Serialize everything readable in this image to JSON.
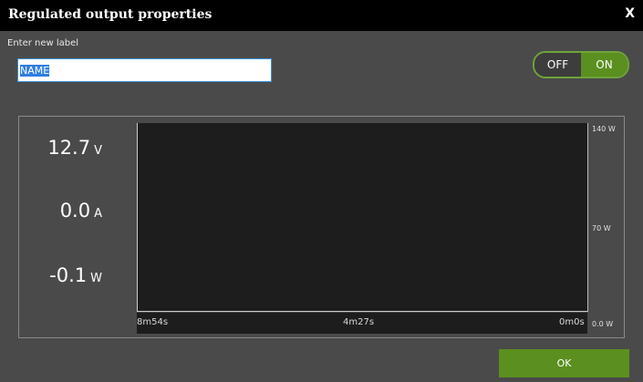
{
  "dialog": {
    "title": "Regulated output properties",
    "close_label": "X"
  },
  "label": {
    "caption": "Enter new label",
    "value": "NAME"
  },
  "toggle": {
    "off_label": "OFF",
    "on_label": "ON",
    "state": "on"
  },
  "readings": {
    "voltage": {
      "value": "12.7",
      "unit": "V"
    },
    "current": {
      "value": "0.0",
      "unit": "A"
    },
    "power": {
      "value": "-0.1",
      "unit": "W"
    }
  },
  "chart_data": {
    "type": "line",
    "x_tick_labels": [
      "8m54s",
      "4m27s",
      "0m0s"
    ],
    "y_tick_labels": [
      "140 W",
      "70 W",
      "0.0 W"
    ],
    "ylim": [
      0,
      140
    ],
    "series": []
  },
  "footer": {
    "ok_label": "OK"
  },
  "colors": {
    "accent_green": "#5b8f1f",
    "title_bar": "#000000",
    "dialog_bg": "#4a4a4a",
    "plot_bg": "#1d1d1d"
  }
}
